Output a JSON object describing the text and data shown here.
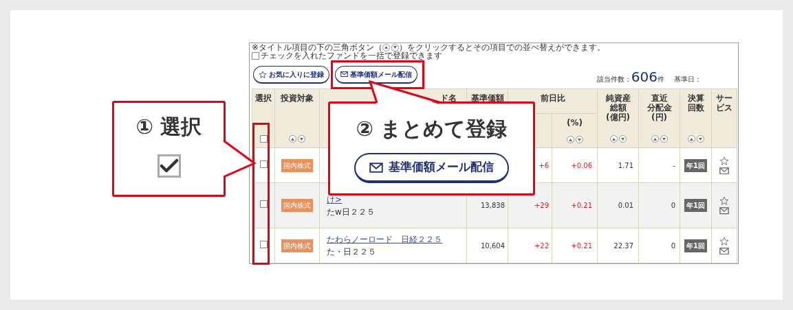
{
  "note": {
    "before": "※タイトル項目の下の三角ボタン（",
    "after": "）をクリックするとその項目での並べ替えができます。"
  },
  "bulk_option": {
    "label": "チェックを入れたファンドを一括で登録できます",
    "checked": false
  },
  "buttons": [
    {
      "label": "お気に入りに登録",
      "kind": "favorite"
    },
    {
      "label": "基準価額メール配信",
      "kind": "mail"
    }
  ],
  "result": {
    "count_label": "該当件数：",
    "count": "606",
    "count_unit": "件",
    "date_label": "基準日："
  },
  "columns": [
    {
      "label": "選択",
      "kind": "select",
      "checked": false
    },
    {
      "label": "投資対象",
      "kind": "sort"
    },
    {
      "label": "ド名",
      "kind": "name"
    },
    {
      "label": "基準価額",
      "kind": "plain"
    },
    {
      "label": "前日比",
      "kind": "group",
      "children": [
        {
          "kind": "plain"
        },
        {
          "label": "(%)",
          "kind": "sort"
        }
      ]
    },
    {
      "lines": [
        "純資産",
        "総額",
        "(億円)"
      ],
      "kind": "sort"
    },
    {
      "lines": [
        "直近",
        "分配金",
        "(円)"
      ],
      "kind": "sort"
    },
    {
      "lines": [
        "決算",
        "回数"
      ],
      "kind": "sort"
    },
    {
      "lines": [
        "サー",
        "ビス"
      ],
      "kind": "plain"
    }
  ],
  "rows": [
    {
      "selected": false,
      "category": "国内株式",
      "change": "+6",
      "change_pct": "+0.06",
      "net_assets": "1.71",
      "distribution": "-",
      "settlements": "年1回"
    },
    {
      "selected": false,
      "category": "国内株式",
      "fund_name": "け>",
      "fund_short": "たw日２２５",
      "price": "13,838",
      "change": "+29",
      "change_pct": "+0.21",
      "net_assets": "0.01",
      "distribution": "0",
      "settlements": "年1回"
    },
    {
      "selected": false,
      "category": "国内株式",
      "fund_name": "たわらノーロード　日経２２５",
      "fund_short": "た・日２２５",
      "price": "10,604",
      "change": "+22",
      "change_pct": "+0.21",
      "net_assets": "22.37",
      "distribution": "0",
      "settlements": "年1回"
    }
  ],
  "callouts": [
    {
      "number": "①",
      "title": "選択",
      "kind": "checkbox",
      "checked": true
    },
    {
      "number": "②",
      "title": "まとめて登録",
      "kind": "button",
      "button_label": "基準価額メール配信"
    }
  ]
}
